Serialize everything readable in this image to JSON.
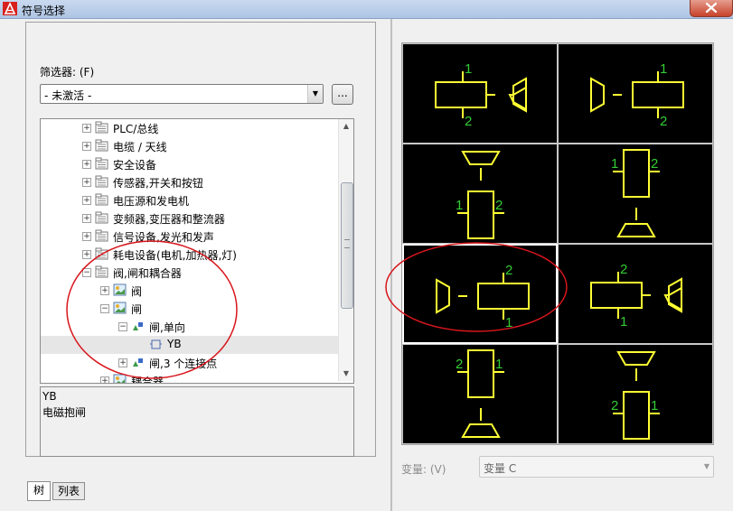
{
  "window": {
    "title": "符号选择"
  },
  "filter": {
    "label": "筛选器: (F)",
    "value": "- 未激活 -",
    "browse_label": "..."
  },
  "tree": {
    "items": [
      {
        "label": "PLC/总线",
        "level": 0,
        "expander": "+",
        "icon": "folder-icon"
      },
      {
        "label": "电缆 / 天线",
        "level": 0,
        "expander": "+",
        "icon": "folder-icon"
      },
      {
        "label": "安全设备",
        "level": 0,
        "expander": "+",
        "icon": "folder-icon"
      },
      {
        "label": "传感器,开关和按钮",
        "level": 0,
        "expander": "+",
        "icon": "folder-icon"
      },
      {
        "label": "电压源和发电机",
        "level": 0,
        "expander": "+",
        "icon": "folder-icon"
      },
      {
        "label": "变频器,变压器和整流器",
        "level": 0,
        "expander": "+",
        "icon": "folder-icon"
      },
      {
        "label": "信号设备,发光和发声",
        "level": 0,
        "expander": "+",
        "icon": "folder-icon"
      },
      {
        "label": "耗电设备(电机,加热器,灯)",
        "level": 0,
        "expander": "+",
        "icon": "folder-icon"
      },
      {
        "label": "阀,闸和耦合器",
        "level": 0,
        "expander": "-",
        "icon": "folder-icon"
      },
      {
        "label": "阀",
        "level": 1,
        "expander": "+",
        "icon": "image-icon"
      },
      {
        "label": "闸",
        "level": 1,
        "expander": "-",
        "icon": "image-icon"
      },
      {
        "label": "闸,单向",
        "level": 2,
        "expander": "-",
        "icon": "shape-icon"
      },
      {
        "label": "YB",
        "level": 3,
        "expander": "",
        "icon": "symbol-icon",
        "selected": true
      },
      {
        "label": "闸,3 个连接点",
        "level": 2,
        "expander": "+",
        "icon": "shape-icon"
      },
      {
        "label": "耦合器",
        "level": 1,
        "expander": "+",
        "icon": "image-icon"
      }
    ]
  },
  "description": {
    "line1": "YB",
    "line2": "电磁抱闸"
  },
  "tabs": {
    "tree_label": "树",
    "list_label": "列表"
  },
  "preview": {
    "symbol_color": "#ffff33",
    "number_color": "#33cc33",
    "selected_index": 4,
    "pin_a": "1",
    "pin_b": "2"
  },
  "variant": {
    "label": "变量: (V)",
    "value": "变量 C"
  }
}
